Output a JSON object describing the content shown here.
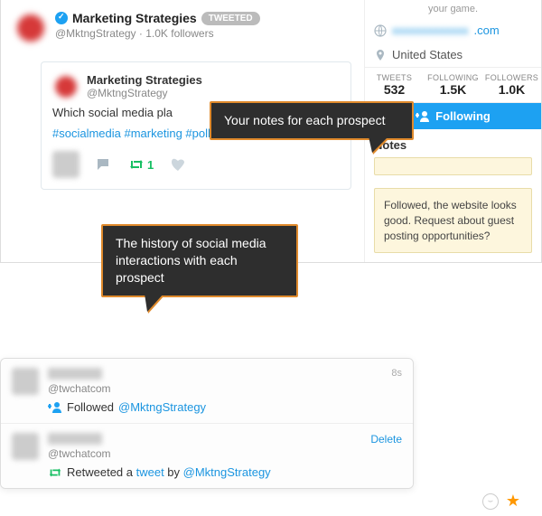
{
  "profile": {
    "name": "Marketing Strategies",
    "badge": "TWEETED",
    "handle": "@MktngStrategy",
    "followers_text": "1.0K followers"
  },
  "tweet": {
    "author": "Marketing Strategies",
    "handle": "@MktngStrategy",
    "body": "Which social media pla",
    "hashtags": "#socialmedia #marketing #poll",
    "retweet_count": "1"
  },
  "sidebar": {
    "truncated": "your game.",
    "url_blur": "xxxxxxxxxxxxx",
    "url_suffix": ".com",
    "location": "United States",
    "stats": {
      "tweets": {
        "label": "TWEETS",
        "value": "532"
      },
      "following": {
        "label": "FOLLOWING",
        "value": "1.5K"
      },
      "followers": {
        "label": "FOLLOWERS",
        "value": "1.0K"
      }
    },
    "follow_button": "Following",
    "notes_heading": "Notes",
    "note_text": "Followed, the website looks good. Request about guest posting opportunities?"
  },
  "callouts": {
    "notes": "Your notes for each prospect",
    "history": "The history of social media interactions with each prospect"
  },
  "history": {
    "item1": {
      "handle": "@twchatcom",
      "action": "Followed",
      "target": "@MktngStrategy",
      "time": "8s"
    },
    "item2": {
      "handle": "@twchatcom",
      "action_pre": "Retweeted a ",
      "action_link": "tweet",
      "action_mid": " by ",
      "target": "@MktngStrategy",
      "delete": "Delete"
    }
  }
}
